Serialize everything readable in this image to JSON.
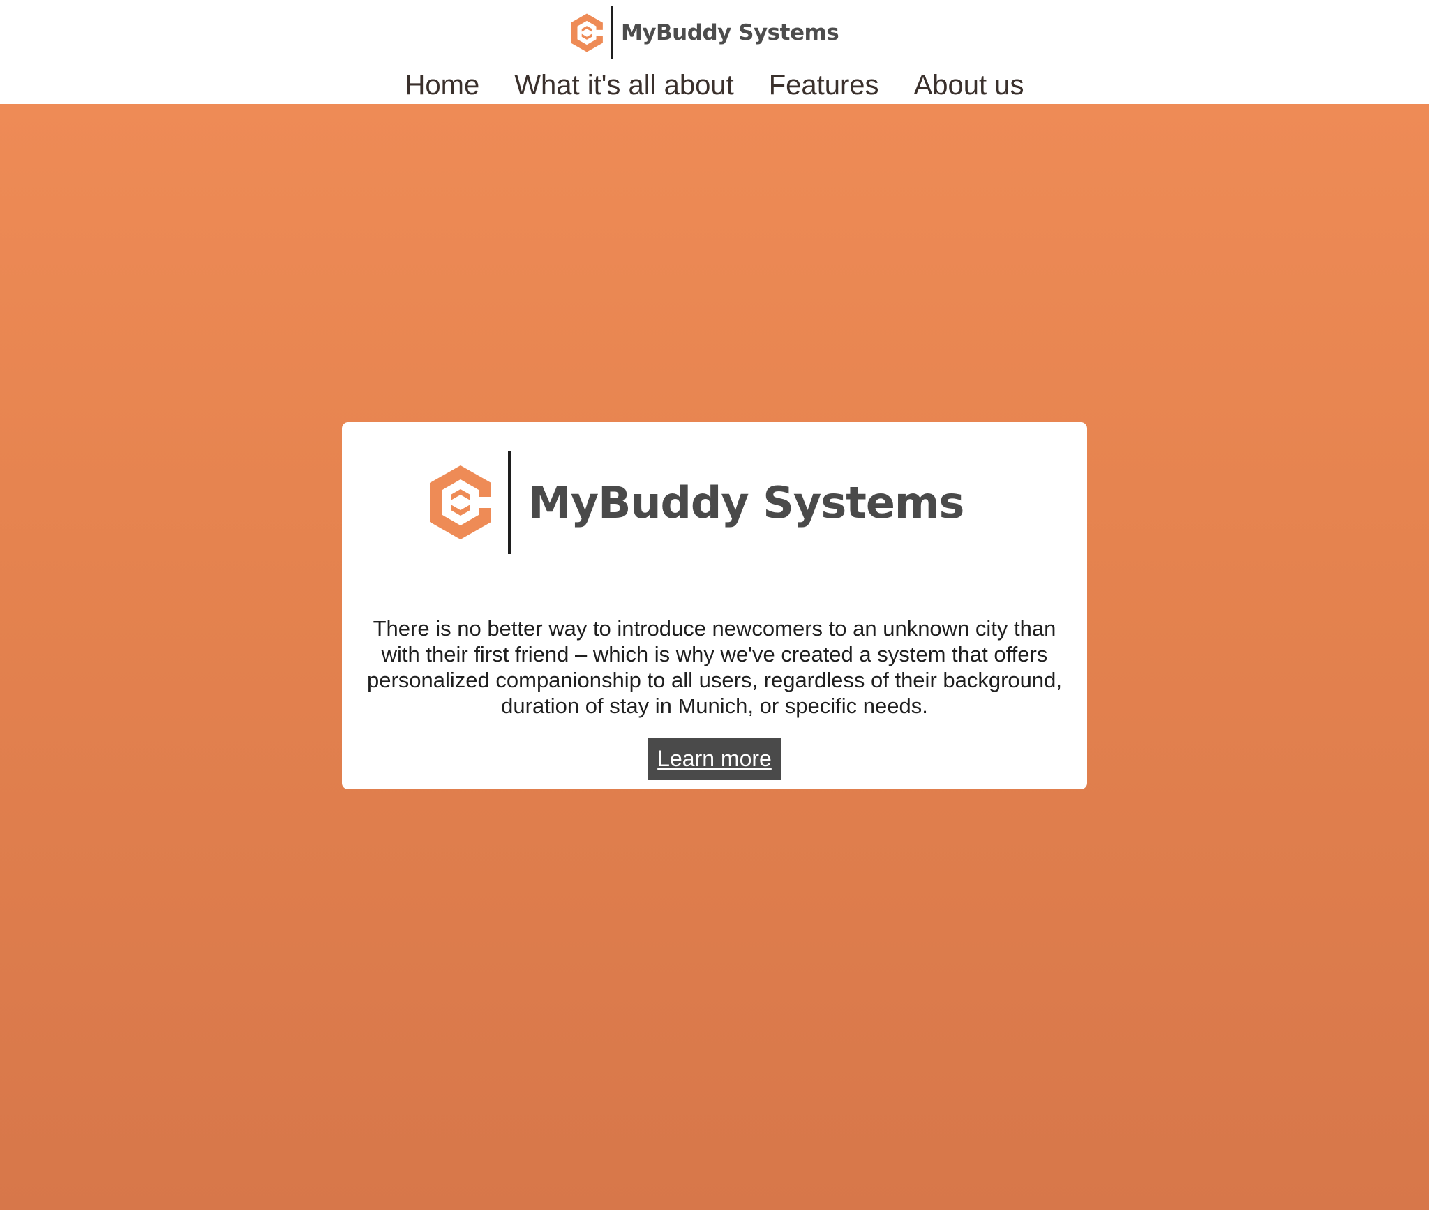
{
  "header": {
    "brand": "MyBuddy Systems",
    "logo_icon": "hexagon-c-logo-icon"
  },
  "nav": {
    "items": [
      {
        "label": "Home"
      },
      {
        "label": "What it's all about"
      },
      {
        "label": "Features"
      },
      {
        "label": "About us"
      }
    ]
  },
  "hero": {
    "brand": "MyBuddy Systems",
    "description": "There is no better way to introduce newcomers to an unknown city than with their first friend – which is why we've created a system that offers personalized companionship to all users, regardless of their background, duration of stay in Munich, or specific needs.",
    "cta_label": "Learn more"
  },
  "colors": {
    "accent": "#ee8b56",
    "accent_dark": "#d7774a",
    "button": "#4a4a4a",
    "text": "#3a302c"
  }
}
